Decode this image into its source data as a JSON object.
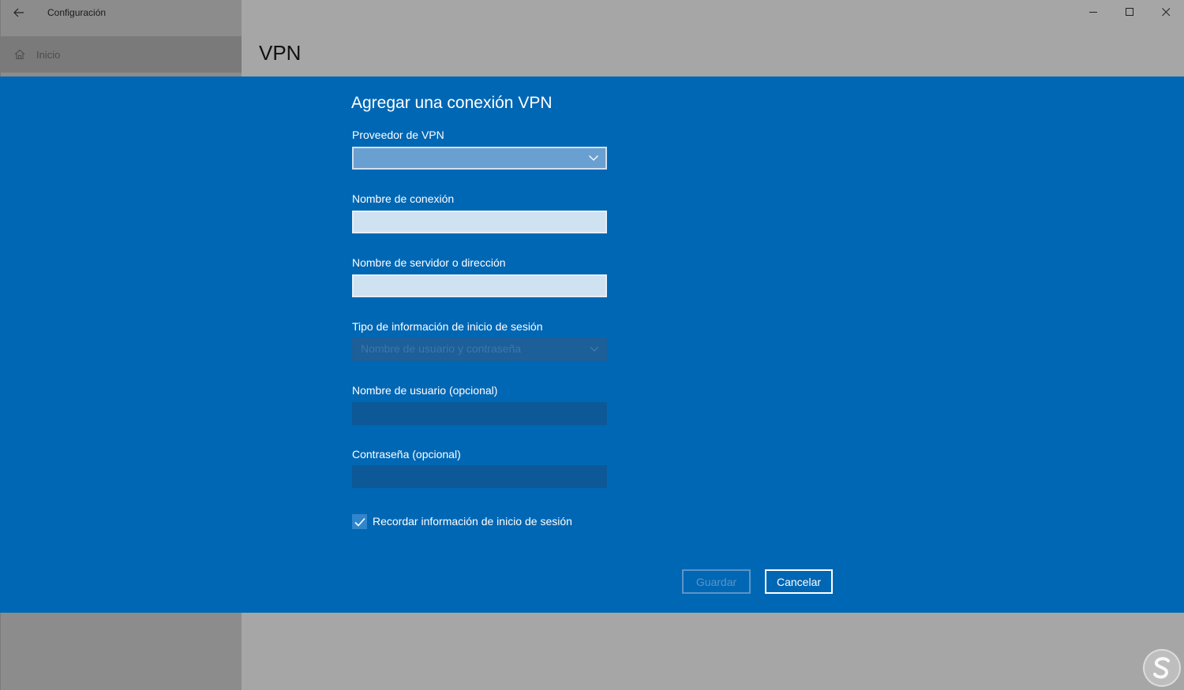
{
  "window": {
    "app_title": "Configuración",
    "back_icon": "back-arrow-icon",
    "controls": [
      "minimize-icon",
      "maximize-icon",
      "close-icon"
    ]
  },
  "sidebar": {
    "home_label": "Inicio",
    "home_icon": "home-icon"
  },
  "page": {
    "title": "VPN"
  },
  "dialog": {
    "title": "Agregar una conexión VPN",
    "provider_label": "Proveedor de VPN",
    "provider_value": "",
    "connection_name_label": "Nombre de conexión",
    "connection_name_value": "",
    "server_label": "Nombre de servidor o dirección",
    "server_value": "",
    "signin_type_label": "Tipo de información de inicio de sesión",
    "signin_type_value": "Nombre de usuario y contraseña",
    "username_label": "Nombre de usuario (opcional)",
    "password_label": "Contraseña (opcional)",
    "remember_label": "Recordar información de inicio de sesión",
    "remember_checked": true,
    "save_label": "Guardar",
    "cancel_label": "Cancelar"
  },
  "colors": {
    "dialog_bg": "#0067b4",
    "sidebar_bg": "#8c8c8c",
    "main_bg": "#a6a6a6"
  }
}
